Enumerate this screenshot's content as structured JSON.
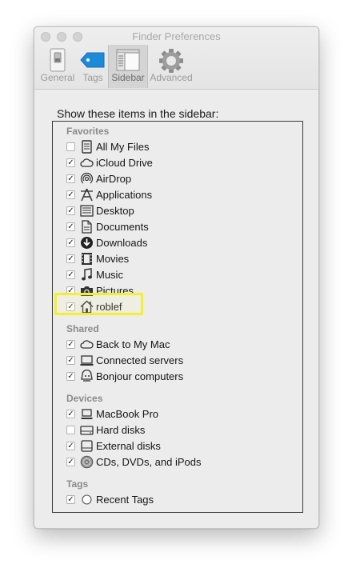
{
  "window": {
    "title": "Finder Preferences"
  },
  "tabs": [
    {
      "label": "General",
      "icon": "switch-icon",
      "active": false
    },
    {
      "label": "Tags",
      "icon": "tag-icon",
      "active": false
    },
    {
      "label": "Sidebar",
      "icon": "sidebar-icon",
      "active": true
    },
    {
      "label": "Advanced",
      "icon": "gear-icon",
      "active": false
    }
  ],
  "heading": "Show these items in the sidebar:",
  "sections": {
    "favorites": {
      "title": "Favorites",
      "items": [
        {
          "label": "All My Files",
          "checked": false,
          "icon": "all-my-files-icon"
        },
        {
          "label": "iCloud Drive",
          "checked": true,
          "icon": "cloud-icon"
        },
        {
          "label": "AirDrop",
          "checked": true,
          "icon": "airdrop-icon"
        },
        {
          "label": "Applications",
          "checked": true,
          "icon": "applications-icon"
        },
        {
          "label": "Desktop",
          "checked": true,
          "icon": "desktop-icon"
        },
        {
          "label": "Documents",
          "checked": true,
          "icon": "documents-icon"
        },
        {
          "label": "Downloads",
          "checked": true,
          "icon": "downloads-icon"
        },
        {
          "label": "Movies",
          "checked": true,
          "icon": "movies-icon"
        },
        {
          "label": "Music",
          "checked": true,
          "icon": "music-icon"
        },
        {
          "label": "Pictures",
          "checked": true,
          "icon": "camera-icon"
        },
        {
          "label": "roblef",
          "checked": true,
          "icon": "home-icon"
        }
      ]
    },
    "shared": {
      "title": "Shared",
      "items": [
        {
          "label": "Back to My Mac",
          "checked": true,
          "icon": "cloud-icon"
        },
        {
          "label": "Connected servers",
          "checked": true,
          "icon": "display-icon"
        },
        {
          "label": "Bonjour computers",
          "checked": true,
          "icon": "bonjour-icon"
        }
      ]
    },
    "devices": {
      "title": "Devices",
      "items": [
        {
          "label": "MacBook Pro",
          "checked": true,
          "icon": "laptop-icon"
        },
        {
          "label": "Hard disks",
          "checked": false,
          "icon": "hard-disk-icon"
        },
        {
          "label": "External disks",
          "checked": true,
          "icon": "external-disk-icon"
        },
        {
          "label": "CDs, DVDs, and iPods",
          "checked": true,
          "icon": "disc-icon"
        }
      ]
    },
    "tags": {
      "title": "Tags",
      "items": [
        {
          "label": "Recent Tags",
          "checked": true,
          "icon": "tag-circle-icon"
        }
      ]
    }
  },
  "checkmark": "✓",
  "colors": {
    "highlight": "#f4ef2c",
    "tags_blue": "#1c8ad8"
  }
}
